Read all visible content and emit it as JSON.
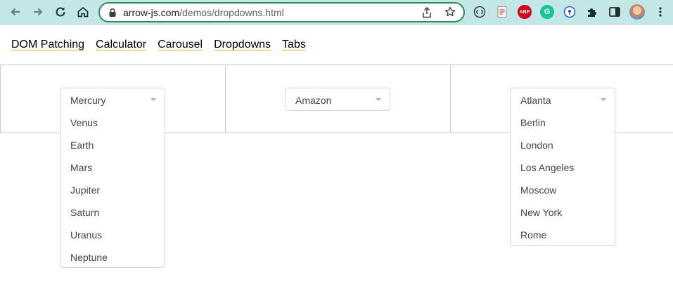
{
  "browser": {
    "url_host": "arrow-js.com",
    "url_path": "/demos/dropdowns.html"
  },
  "nav": {
    "links": [
      "DOM Patching",
      "Calculator",
      "Carousel",
      "Dropdowns",
      "Tabs"
    ]
  },
  "dropdowns": {
    "planets": {
      "selected": "Mercury",
      "options": [
        "Venus",
        "Earth",
        "Mars",
        "Jupiter",
        "Saturn",
        "Uranus",
        "Neptune"
      ]
    },
    "stores": {
      "selected": "Amazon"
    },
    "cities": {
      "selected": "Atlanta",
      "options": [
        "Berlin",
        "London",
        "Los Angeles",
        "Moscow",
        "New York",
        "Rome"
      ]
    }
  },
  "colors": {
    "omnibox_border": "#2e8b57",
    "toolbar_bg": "#c3e6e6",
    "link_underline": "#e8b400"
  }
}
